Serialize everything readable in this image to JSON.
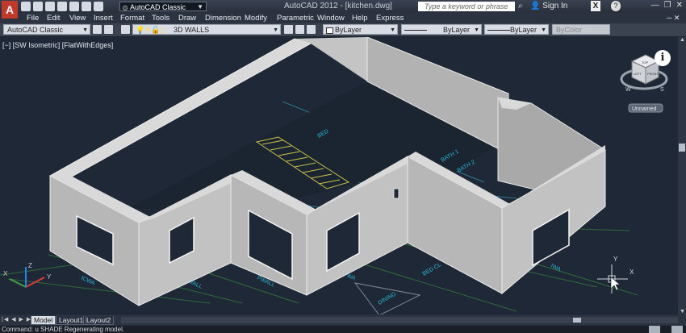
{
  "app": {
    "logo": "A",
    "title": "AutoCAD 2012 - [kitchen.dwg]"
  },
  "workspace": {
    "value": "AutoCAD Classic"
  },
  "search": {
    "placeholder": "Type a keyword or phrase"
  },
  "signin": {
    "label": "Sign In"
  },
  "menu": [
    "File",
    "Edit",
    "View",
    "Insert",
    "Format",
    "Tools",
    "Draw",
    "Dimension",
    "Modify",
    "Parametric",
    "Window",
    "Help",
    "Express"
  ],
  "toolbar": {
    "workspace2": "AutoCAD Classic",
    "layer": "3D WALLS",
    "color": "ByLayer",
    "linetype": "ByLayer",
    "lineweight": "ByLayer",
    "plotstyle": "ByColor"
  },
  "viewport": {
    "label": "[−] [SW Isometric] [FlatWithEdges]",
    "viewcube_top": "TOP",
    "viewcube_left": "LEFT",
    "viewcube_front": "FRONT",
    "compass_w": "W",
    "compass_s": "S",
    "ucs_name": "Unnamed",
    "ucs_x": "X",
    "ucs_y": "Y",
    "ucs_z": "Z"
  },
  "drawing_labels": {
    "bed": "BED",
    "bath1": "BATH 1",
    "bath2": "BATH 2",
    "wall1": "ICWA",
    "wall2": "KWALL",
    "wall3": "PWALL",
    "wall4": "PWA",
    "wall5": "ICWA",
    "bed2": "BED CL",
    "dining": "DINING",
    "wall6": "IWA"
  },
  "tabs": [
    "Model",
    "Layout1",
    "Layout2"
  ],
  "tab_nav": "|◀ ◀ ▶ ▶|",
  "command": {
    "text": "Command: u SHADE Regenerating model."
  },
  "colors": {
    "wall": "#b7b7b7",
    "wall_top": "#d9d9d9",
    "background": "#1f2836",
    "grid": "#2f6b3a",
    "stair": "#c9c24a"
  }
}
